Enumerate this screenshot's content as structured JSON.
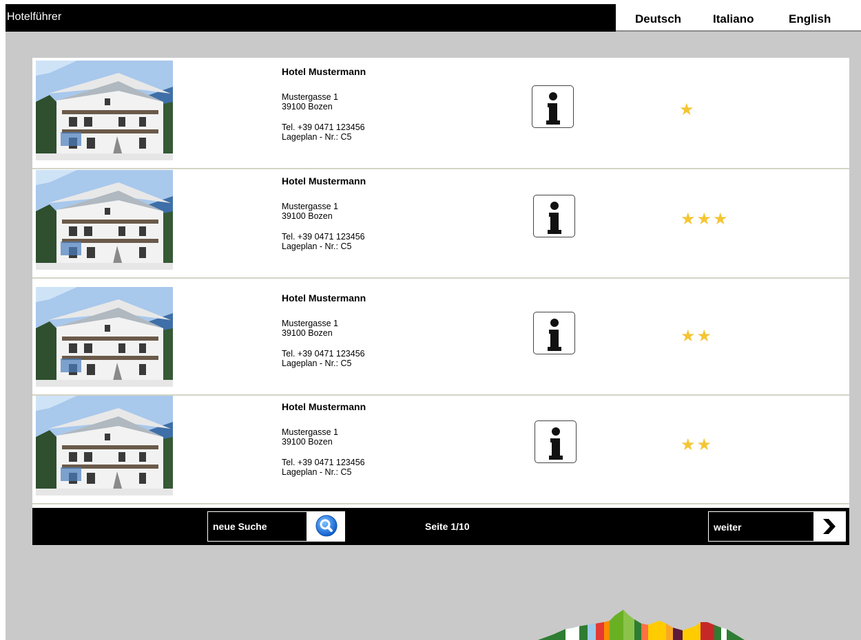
{
  "header": {
    "title": "Hotelführer",
    "languages": [
      "Deutsch",
      "Italiano",
      "English"
    ]
  },
  "hotels": [
    {
      "name": "Hotel Mustermann",
      "street": "Mustergasse 1",
      "city": "39100 Bozen",
      "phone": "Tel. +39 0471 123456",
      "map_ref": "Lageplan - Nr.: C5",
      "stars": "★",
      "star_count": 1
    },
    {
      "name": "Hotel Mustermann",
      "street": "Mustergasse 1",
      "city": "39100 Bozen",
      "phone": "Tel. +39 0471 123456",
      "map_ref": "Lageplan - Nr.: C5",
      "stars": "★★★",
      "star_count": 3
    },
    {
      "name": "Hotel Mustermann",
      "street": "Mustergasse 1",
      "city": "39100 Bozen",
      "phone": "Tel. +39 0471 123456",
      "map_ref": "Lageplan - Nr.: C5",
      "stars": "★★",
      "star_count": 2
    },
    {
      "name": "Hotel Mustermann",
      "street": "Mustergasse 1",
      "city": "39100 Bozen",
      "phone": "Tel. +39 0471 123456",
      "map_ref": "Lageplan - Nr.: C5",
      "stars": "★★",
      "star_count": 2
    }
  ],
  "pager": {
    "new_search_label": "neue Suche",
    "page_label": "Seite 1/10",
    "next_label": "weiter"
  },
  "icons": {
    "info": "info-icon",
    "search": "search-icon",
    "next": "chevron-right-icon",
    "logo": "mountain-logo"
  },
  "colors": {
    "background": "#c9c9c9",
    "bar": "#000000",
    "star": "#f4c534",
    "search_icon": "#1e6fd9"
  }
}
